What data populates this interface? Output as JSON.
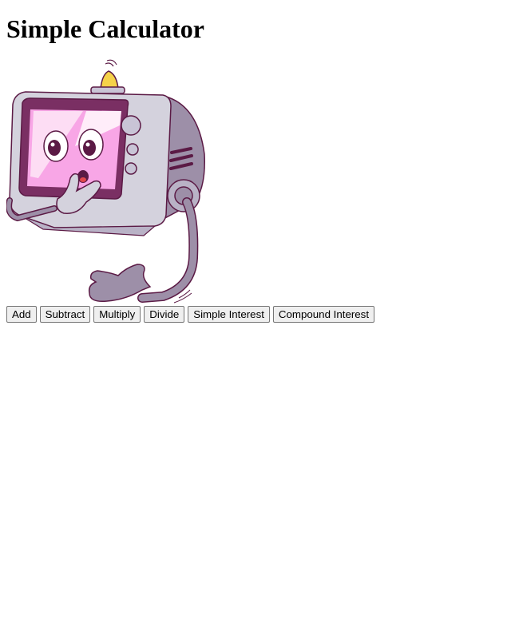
{
  "page": {
    "title": "Simple Calculator"
  },
  "illustration": {
    "subject": "cartoon-microwave-robot"
  },
  "buttons": {
    "add": "Add",
    "subtract": "Subtract",
    "multiply": "Multiply",
    "divide": "Divide",
    "simple_interest": "Simple Interest",
    "compound_interest": "Compound Interest"
  },
  "colors": {
    "body_gray": "#d4d2dd",
    "dark_outline": "#5b1a45",
    "screen_pink": "#f8a6e6",
    "arm_gray": "#9d8fa8",
    "bell_yellow": "#f5d24a",
    "button_bg": "#efefef",
    "button_border": "#767676"
  }
}
